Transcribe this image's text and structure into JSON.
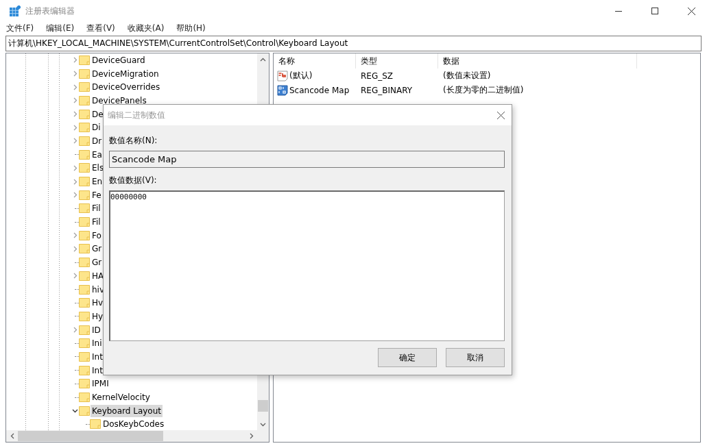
{
  "window": {
    "title": "注册表编辑器"
  },
  "menu": [
    "文件(F)",
    "编辑(E)",
    "查看(V)",
    "收藏夹(A)",
    "帮助(H)"
  ],
  "address": "计算机\\HKEY_LOCAL_MACHINE\\SYSTEM\\CurrentControlSet\\Control\\Keyboard Layout",
  "tree": {
    "items": [
      {
        "label": "DeviceGuard",
        "kind": "branch",
        "expanded": false,
        "selected": false
      },
      {
        "label": "DeviceMigration",
        "kind": "branch",
        "expanded": false,
        "selected": false
      },
      {
        "label": "DeviceOverrides",
        "kind": "branch",
        "expanded": false,
        "selected": false
      },
      {
        "label": "DevicePanels",
        "kind": "branch",
        "expanded": false,
        "selected": false
      },
      {
        "label": "De",
        "kind": "branch",
        "expanded": false,
        "selected": false
      },
      {
        "label": "Di",
        "kind": "branch",
        "expanded": false,
        "selected": false
      },
      {
        "label": "Dr",
        "kind": "branch",
        "expanded": false,
        "selected": false
      },
      {
        "label": "Ea",
        "kind": "leaf",
        "selected": false
      },
      {
        "label": "Els",
        "kind": "branch",
        "expanded": false,
        "selected": false
      },
      {
        "label": "En",
        "kind": "branch",
        "expanded": false,
        "selected": false
      },
      {
        "label": "Fe",
        "kind": "branch",
        "expanded": false,
        "selected": false
      },
      {
        "label": "Fil",
        "kind": "leaf",
        "selected": false
      },
      {
        "label": "Fil",
        "kind": "leaf",
        "selected": false
      },
      {
        "label": "Fo",
        "kind": "branch",
        "expanded": false,
        "selected": false
      },
      {
        "label": "Gr",
        "kind": "branch",
        "expanded": false,
        "selected": false
      },
      {
        "label": "Gr",
        "kind": "leaf",
        "selected": false
      },
      {
        "label": "HA",
        "kind": "branch",
        "expanded": false,
        "selected": false
      },
      {
        "label": "hiv",
        "kind": "leaf",
        "selected": false
      },
      {
        "label": "Hv",
        "kind": "leaf",
        "selected": false
      },
      {
        "label": "Hy",
        "kind": "leaf",
        "selected": false
      },
      {
        "label": "ID",
        "kind": "branch",
        "expanded": false,
        "selected": false
      },
      {
        "label": "Ini",
        "kind": "leaf",
        "selected": false
      },
      {
        "label": "Int",
        "kind": "leaf",
        "selected": false
      },
      {
        "label": "Int",
        "kind": "leaf",
        "selected": false
      },
      {
        "label": "IPMI",
        "kind": "leaf",
        "selected": false
      },
      {
        "label": "KernelVelocity",
        "kind": "leaf",
        "selected": false
      },
      {
        "label": "Keyboard Layout",
        "kind": "branch",
        "expanded": true,
        "selected": true,
        "children": [
          {
            "label": "DosKeybCodes",
            "kind": "leaf",
            "selected": false
          }
        ]
      }
    ]
  },
  "list": {
    "columns": [
      "名称",
      "类型",
      "数据"
    ],
    "rows": [
      {
        "kind": "string",
        "name": "(默认)",
        "type": "REG_SZ",
        "data": "(数值未设置)"
      },
      {
        "kind": "binary",
        "name": "Scancode Map",
        "type": "REG_BINARY",
        "data": "(长度为零的二进制值)"
      }
    ]
  },
  "dialog": {
    "title": "编辑二进制数值",
    "name_label": "数值名称(N):",
    "name_value": "Scancode Map",
    "data_label": "数值数据(V):",
    "data_value": "00000000",
    "buttons": [
      "确定",
      "取消"
    ]
  }
}
